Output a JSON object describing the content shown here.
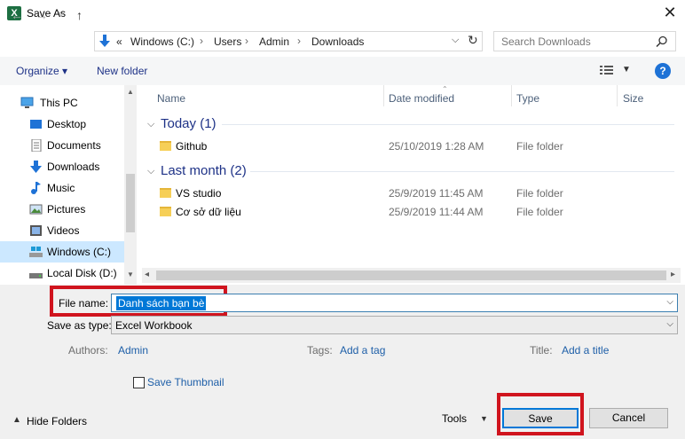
{
  "window": {
    "title": "Save As",
    "app_icon": "X"
  },
  "nav": {
    "back": "←",
    "forward": "→",
    "recent": "˅",
    "up": "↑",
    "path": [
      "«",
      "Windows (C:)",
      "Users",
      "Admin",
      "Downloads"
    ],
    "search_placeholder": "Search Downloads"
  },
  "toolbar": {
    "organize": "Organize ▾",
    "new_folder": "New folder",
    "help": "?"
  },
  "sidebar": {
    "items": [
      {
        "label": "This PC",
        "icon": "pc-icon"
      },
      {
        "label": "Desktop",
        "icon": "desktop-icon"
      },
      {
        "label": "Documents",
        "icon": "documents-icon"
      },
      {
        "label": "Downloads",
        "icon": "download-icon"
      },
      {
        "label": "Music",
        "icon": "music-icon"
      },
      {
        "label": "Pictures",
        "icon": "pictures-icon"
      },
      {
        "label": "Videos",
        "icon": "videos-icon"
      },
      {
        "label": "Windows (C:)",
        "icon": "drive-icon"
      },
      {
        "label": "Local Disk (D:)",
        "icon": "drive-icon"
      }
    ]
  },
  "columns": {
    "name": "Name",
    "date": "Date modified",
    "type": "Type",
    "size": "Size"
  },
  "groups": [
    {
      "title": "Today (1)",
      "files": [
        {
          "name": "Github",
          "date": "25/10/2019 1:28 AM",
          "type": "File folder"
        }
      ]
    },
    {
      "title": "Last month (2)",
      "files": [
        {
          "name": "VS studio",
          "date": "25/9/2019 11:45 AM",
          "type": "File folder"
        },
        {
          "name": "Cơ sở dữ liệu",
          "date": "25/9/2019 11:44 AM",
          "type": "File folder"
        }
      ]
    }
  ],
  "form": {
    "file_name_label": "File name:",
    "file_name_value": "Danh sách bạn bè",
    "save_type_label": "Save as type:",
    "save_type_value": "Excel Workbook",
    "authors_label": "Authors:",
    "authors_value": "Admin",
    "tags_label": "Tags:",
    "tags_value": "Add a tag",
    "title_label": "Title:",
    "title_value": "Add a title",
    "thumbnail_label": "Save Thumbnail"
  },
  "footer": {
    "hide_folders": "Hide Folders",
    "tools": "Tools",
    "save": "Save",
    "cancel": "Cancel"
  },
  "colors": {
    "accent": "#0078d7",
    "highlight": "#d0141e",
    "link": "#1e5fa8"
  }
}
